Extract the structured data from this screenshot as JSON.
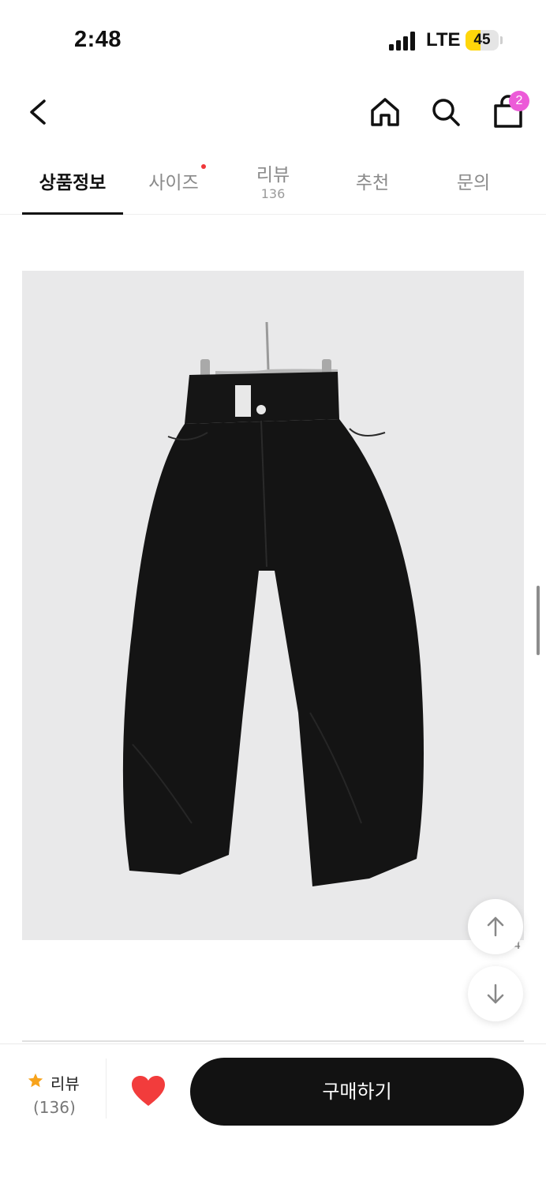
{
  "status_bar": {
    "time": "2:48",
    "network": "LTE",
    "battery": "45",
    "battery_level": 0.45
  },
  "header": {
    "back_icon": "chevron-left-icon",
    "home_icon": "home-icon",
    "search_icon": "search-icon",
    "cart_icon": "shopping-bag-icon",
    "cart_badge": "2",
    "badge_color": "#ec5bd8"
  },
  "tabs": [
    {
      "label": "상품정보",
      "sub": "",
      "active": true
    },
    {
      "label": "사이즈",
      "sub": "",
      "dot": true
    },
    {
      "label": "리뷰",
      "sub": "136"
    },
    {
      "label": "추천",
      "sub": ""
    },
    {
      "label": "문의",
      "sub": ""
    }
  ],
  "product": {
    "image_icon": "black-wide-pants-photo",
    "corner_mark": "4"
  },
  "floating": {
    "up_icon": "arrow-up-icon",
    "down_icon": "arrow-down-icon"
  },
  "bottom_bar": {
    "review_icon": "star-icon",
    "review_label": "리뷰",
    "review_count": "(136)",
    "like_icon": "heart-icon",
    "like_color": "#f23c3c",
    "star_color": "#f7a31c",
    "buy_label": "구매하기"
  }
}
